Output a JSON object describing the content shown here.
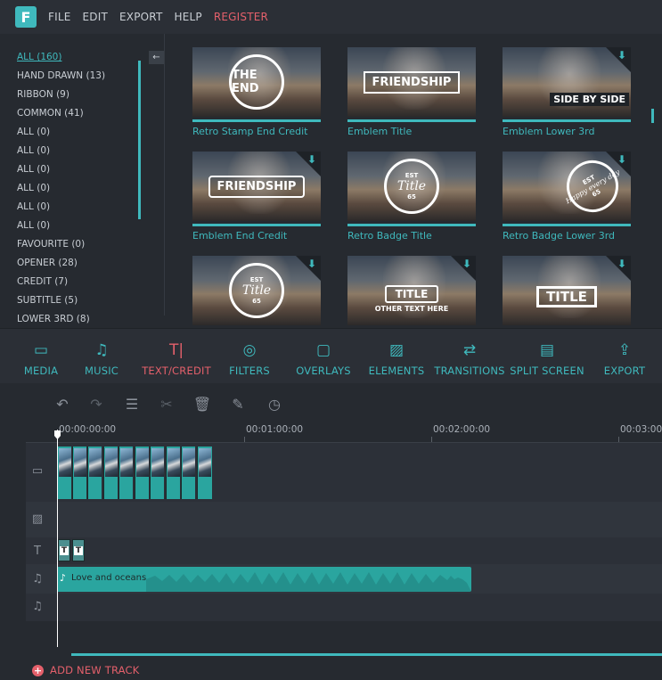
{
  "app": {
    "logo_letter": "F"
  },
  "menu": {
    "items": [
      "FILE",
      "EDIT",
      "EXPORT",
      "HELP",
      "REGISTER"
    ]
  },
  "categories": [
    "ALL (160)",
    "HAND DRAWN (13)",
    "RIBBON (9)",
    "COMMON (41)",
    "ALL (0)",
    "ALL (0)",
    "ALL (0)",
    "ALL (0)",
    "ALL (0)",
    "ALL (0)",
    "FAVOURITE (0)",
    "OPENER (28)",
    "CREDIT (7)",
    "SUBTITLE (5)",
    "LOWER 3RD (8)"
  ],
  "back_arrow": "←",
  "tiles": [
    {
      "label": "Retro Stamp End Credit",
      "art": "THE END",
      "download": false
    },
    {
      "label": "Emblem Title",
      "art": "FRIENDSHIP",
      "download": false
    },
    {
      "label": "Emblem Lower 3rd",
      "art": "SIDE BY SIDE",
      "download": true
    },
    {
      "label": "Emblem End Credit",
      "art": "FRIENDSHIP",
      "download": true
    },
    {
      "label": "Retro Badge Title",
      "art_top": "EST",
      "art_main": "Title",
      "art_bottom": "65",
      "download": false
    },
    {
      "label": "Retro Badge Lower 3rd",
      "art_top": "EST",
      "art_main": "Happy every day",
      "art_bottom": "65",
      "download": true
    },
    {
      "label": "",
      "art_top": "EST",
      "art_main": "Title",
      "art_bottom": "65",
      "download": true
    },
    {
      "label": "",
      "art_main": "TITLE",
      "art_bottom": "OTHER TEXT HERE",
      "download": true
    },
    {
      "label": "",
      "art_main": "TITLE",
      "download": true
    }
  ],
  "download_glyph": "⬇",
  "toolbar": {
    "items": [
      {
        "label": "MEDIA",
        "icon": "folder-icon",
        "glyph": "▭"
      },
      {
        "label": "MUSIC",
        "icon": "music-note-icon",
        "glyph": "♫"
      },
      {
        "label": "TEXT/CREDIT",
        "icon": "text-cursor-icon",
        "glyph": "T|"
      },
      {
        "label": "FILTERS",
        "icon": "filter-circles-icon",
        "glyph": "◎"
      },
      {
        "label": "OVERLAYS",
        "icon": "overlay-square-icon",
        "glyph": "▢"
      },
      {
        "label": "ELEMENTS",
        "icon": "image-icon",
        "glyph": "▨"
      },
      {
        "label": "TRANSITIONS",
        "icon": "transition-arrows-icon",
        "glyph": "⇄"
      },
      {
        "label": "SPLIT SCREEN",
        "icon": "split-screen-icon",
        "glyph": "▤"
      },
      {
        "label": "EXPORT",
        "icon": "export-icon",
        "glyph": "⇪"
      }
    ],
    "active": "TEXT/CREDIT",
    "accent": "#3fb9bd",
    "active_color": "#e4606b"
  },
  "timeline_tools": [
    {
      "name": "undo-icon",
      "glyph": "↶"
    },
    {
      "name": "redo-icon",
      "glyph": "↷"
    },
    {
      "name": "adjust-sliders-icon",
      "glyph": "☰"
    },
    {
      "name": "scissors-icon",
      "glyph": "✂"
    },
    {
      "name": "trash-icon",
      "glyph": "🗑"
    },
    {
      "name": "edit-icon",
      "glyph": "✎"
    },
    {
      "name": "clock-icon",
      "glyph": "◷"
    }
  ],
  "ruler": {
    "labels": [
      "00:00:00:00",
      "00:01:00:00",
      "00:02:00:00",
      "00:03:00"
    ]
  },
  "tracks": [
    {
      "name": "video-track",
      "icon": "video-camera-icon",
      "glyph": "▭"
    },
    {
      "name": "image-track",
      "icon": "image-icon",
      "glyph": "▨"
    },
    {
      "name": "text-track",
      "icon": "text-icon",
      "glyph": "T"
    },
    {
      "name": "music-track-1",
      "icon": "music-note-icon",
      "glyph": "♫"
    },
    {
      "name": "music-track-2",
      "icon": "music-note-icon",
      "glyph": "♫"
    }
  ],
  "video_clip_count": 10,
  "title_clips": [
    "T",
    "T"
  ],
  "audio_clip": {
    "label": "Love and oceans",
    "note": "♪"
  },
  "add_track": {
    "plus": "+",
    "label": "ADD NEW TRACK"
  }
}
